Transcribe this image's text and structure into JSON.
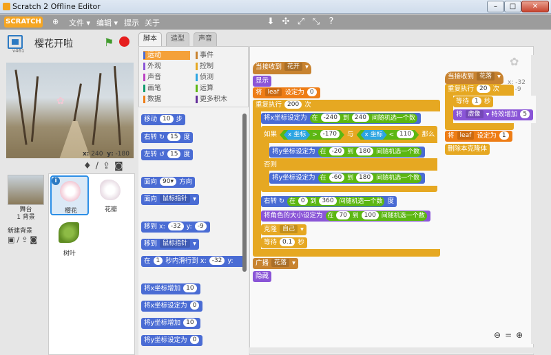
{
  "window": {
    "title": "Scratch 2 Offline Editor"
  },
  "menu": {
    "file": "文件",
    "edit": "编辑",
    "tips": "提示",
    "about": "关于",
    "logo": "SCRATCH"
  },
  "stage": {
    "title": "樱花开啦",
    "version": "v461",
    "x_label": "x:",
    "x_value": "240",
    "y_label": "y:",
    "y_value": "-180"
  },
  "sprites": {
    "stage_label": "舞台",
    "stage_bg_count": "1 背景",
    "new_bg_label": "新建背景",
    "items": [
      {
        "name": "樱花"
      },
      {
        "name": "花瓣"
      },
      {
        "name": "树叶"
      }
    ]
  },
  "tabs": [
    "脚本",
    "造型",
    "声音"
  ],
  "categories": [
    {
      "label": "运动",
      "color": "#4a6cd4"
    },
    {
      "label": "事件",
      "color": "#c88330"
    },
    {
      "label": "外观",
      "color": "#8a55d7"
    },
    {
      "label": "控制",
      "color": "#e6a822"
    },
    {
      "label": "声音",
      "color": "#bb42c3"
    },
    {
      "label": "侦测",
      "color": "#2ca5e2"
    },
    {
      "label": "画笔",
      "color": "#0e9a6c"
    },
    {
      "label": "运算",
      "color": "#5cb712"
    },
    {
      "label": "数据",
      "color": "#ee7d16"
    },
    {
      "label": "更多积木",
      "color": "#632d99"
    }
  ],
  "palette": {
    "move": "移动",
    "move_val": "10",
    "steps": "步",
    "turn_right": "右转",
    "turn_right_val": "15",
    "deg1": "度",
    "turn_left": "左转",
    "turn_left_val": "15",
    "deg2": "度",
    "point_dir": "面向",
    "point_dir_val": "90▾",
    "direction": "方向",
    "point_towards": "面向",
    "point_towards_val": "鼠标指针",
    "goto_xy": "移到 x:",
    "goto_x": "-32",
    "goto_y_label": "y:",
    "goto_y": "-9",
    "goto": "移到",
    "goto_val": "鼠标指针",
    "glide_in": "在",
    "glide_secs": "1",
    "glide_text": "秒内滑行到 x:",
    "glide_x": "-32",
    "glide_y_label": "y:",
    "change_x": "将x坐标增加",
    "change_x_val": "10",
    "set_x": "将x坐标设定为",
    "set_x_val": "0",
    "change_y": "将y坐标增加",
    "change_y_val": "10",
    "set_y": "将y坐标设定为",
    "set_y_val": "0"
  },
  "script1": {
    "hat": "当接收到",
    "hat_msg": "花开",
    "show": "显示",
    "set": "将",
    "set_var": "leaf",
    "set_to": "设定为",
    "set_val": "0",
    "repeat": "重复执行",
    "repeat_n": "200",
    "repeat_unit": "次",
    "setx": "将x坐标设定为",
    "in": "在",
    "setx_a": "-240",
    "to": "到",
    "setx_b": "240",
    "rand": "间随机选一个数",
    "if": "如果",
    "xpos": "x 坐标",
    "gt": ">",
    "gt_val": "-170",
    "and": "与",
    "xpos2": "x 坐标",
    "lt": "<",
    "lt_val": "110",
    "then": "那么",
    "sety1": "将y坐标设定为",
    "sety1_a": "-20",
    "sety1_b": "180",
    "else": "否则",
    "sety2": "将y坐标设定为",
    "sety2_a": "-60",
    "sety2_b": "180",
    "turn": "右转",
    "turn_a": "0",
    "turn_b": "360",
    "turn_deg": "度",
    "size": "将角色的大小设定为",
    "size_a": "70",
    "size_b": "100",
    "clone": "克隆",
    "clone_of": "自己",
    "wait": "等待",
    "wait_val": "0.1",
    "wait_unit": "秒",
    "broadcast": "广播",
    "broadcast_msg": "花落",
    "hide": "隐藏"
  },
  "script2": {
    "hat": "当接收到",
    "hat_msg": "花落",
    "repeat": "重复执行",
    "repeat_n": "20",
    "repeat_unit": "次",
    "wait": "等待",
    "wait_val": "1",
    "wait_unit": "秒",
    "effect": "将",
    "effect_name": "虚像",
    "effect_change": "特效增加",
    "effect_val": "5",
    "set": "将",
    "set_var": "leaf",
    "set_to": "设定为",
    "set_val": "1",
    "delete": "删除本克隆体"
  },
  "script_area": {
    "x_label": "x:",
    "x_value": "-32",
    "y_label": "y:",
    "y_value": "-9"
  }
}
